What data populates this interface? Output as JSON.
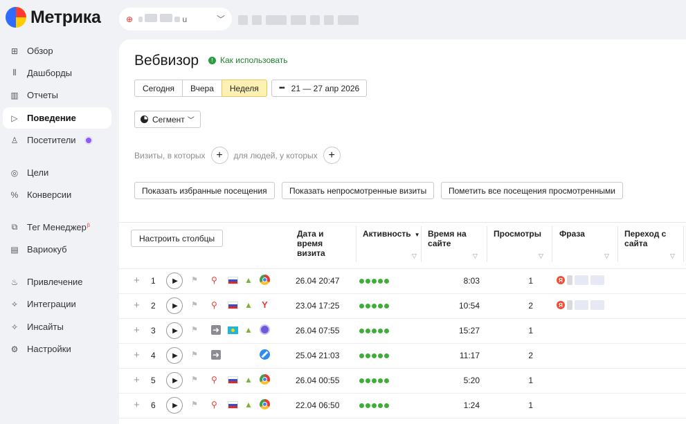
{
  "app": {
    "logo_text": "Метрика"
  },
  "counter": {
    "name_blurred": "u"
  },
  "sidebar": {
    "items": [
      {
        "label": "Обзор",
        "icon": "grid-icon"
      },
      {
        "label": "Дашборды",
        "icon": "dashboard-icon"
      },
      {
        "label": "Отчеты",
        "icon": "bar-chart-icon"
      },
      {
        "label": "Поведение",
        "icon": "play-outline-icon",
        "active": true
      },
      {
        "label": "Посетители",
        "icon": "person-icon",
        "badge": true
      },
      {
        "label": "Цели",
        "icon": "target-icon"
      },
      {
        "label": "Конверсии",
        "icon": "percent-icon"
      },
      {
        "label": "Тег Менеджер",
        "icon": "tag-manager-icon",
        "superscript": "β"
      },
      {
        "label": "Вариокуб",
        "icon": "cube-icon"
      },
      {
        "label": "Привлечение",
        "icon": "flame-icon"
      },
      {
        "label": "Интеграции",
        "icon": "puzzle-icon"
      },
      {
        "label": "Инсайты",
        "icon": "sparkle-icon"
      },
      {
        "label": "Настройки",
        "icon": "gear-icon"
      }
    ]
  },
  "page": {
    "title": "Вебвизор",
    "howto": "Как использовать",
    "period_buttons": [
      "Сегодня",
      "Вчера",
      "Неделя"
    ],
    "period_selected": "Неделя",
    "date_range": "21 — 27 апр 2026",
    "segment_label": "Сегмент",
    "filter_visits": "Визиты, в которых",
    "filter_people": "для людей, у которых",
    "actions": {
      "favorites": "Показать избранные посещения",
      "unviewed": "Показать непросмотренные визиты",
      "mark_all": "Пометить все посещения просмотренными"
    }
  },
  "table": {
    "configure_label": "Настроить столбцы",
    "columns": {
      "datetime": "Дата и время визита",
      "activity": "Активность",
      "duration": "Время на сайте",
      "views": "Просмотры",
      "phrase": "Фраза",
      "referrer": "Переход с сайта"
    },
    "rows": [
      {
        "n": "1",
        "date": "26.04 20:47",
        "time": "8:03",
        "views": "1",
        "source": "search",
        "country": "ru",
        "os": "android",
        "browser": "chrome",
        "activity": 5,
        "phrase": true
      },
      {
        "n": "2",
        "date": "23.04 17:25",
        "time": "10:54",
        "views": "2",
        "source": "search",
        "country": "ru",
        "os": "android",
        "browser": "yandex",
        "activity": 5,
        "phrase": true
      },
      {
        "n": "3",
        "date": "26.04 07:55",
        "time": "15:27",
        "views": "1",
        "source": "direct",
        "country": "kz",
        "os": "android",
        "browser": "purple",
        "activity": 5,
        "phrase": false
      },
      {
        "n": "4",
        "date": "25.04 21:03",
        "time": "11:17",
        "views": "2",
        "source": "direct",
        "country": "none",
        "os": "apple",
        "browser": "safari",
        "activity": 5,
        "phrase": false
      },
      {
        "n": "5",
        "date": "26.04 00:55",
        "time": "5:20",
        "views": "1",
        "source": "search",
        "country": "ru",
        "os": "android",
        "browser": "chrome",
        "activity": 5,
        "phrase": false
      },
      {
        "n": "6",
        "date": "22.04 06:50",
        "time": "1:24",
        "views": "1",
        "source": "search",
        "country": "ru",
        "os": "android",
        "browser": "chrome",
        "activity": 5,
        "phrase": false
      }
    ]
  }
}
